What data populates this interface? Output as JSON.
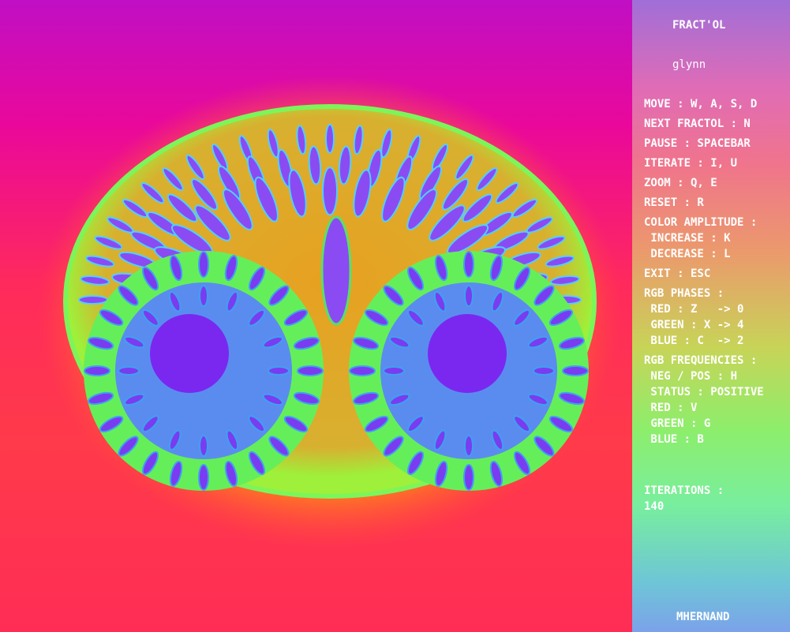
{
  "window": {
    "title": "FRACT'OL"
  },
  "fractal": {
    "name": "glynn"
  },
  "controls": {
    "move": "MOVE : W, A, S, D",
    "next": "NEXT FRACTOL : N",
    "pause": "PAUSE : SPACEBAR",
    "iterate": "ITERATE : I, U",
    "zoom": "ZOOM : Q, E",
    "reset": "RESET : R",
    "color_amplitude": "COLOR AMPLITUDE :",
    "increase": " INCREASE : K",
    "decrease": " DECREASE : L",
    "exit": "EXIT : ESC",
    "rgb_phases": "RGB PHASES :",
    "phase_red": " RED : Z   -> 0",
    "phase_green": " GREEN : X -> 4",
    "phase_blue": " BLUE : C  -> 2",
    "rgb_frequencies": "RGB FREQUENCIES :",
    "neg_pos": " NEG / POS : H",
    "status": " STATUS : POSITIVE",
    "freq_red": " RED : V",
    "freq_green": " GREEN : G",
    "freq_blue": " BLUE : B"
  },
  "iterations": {
    "label": "ITERATIONS :",
    "value": "140"
  },
  "author": "MHERNAND",
  "colors": {
    "fractal_outer": "#a6ff2a",
    "fractal_mid": "#52f0b8",
    "fractal_inner": "#7e2cf0",
    "leaf": "#4a8cf0"
  }
}
